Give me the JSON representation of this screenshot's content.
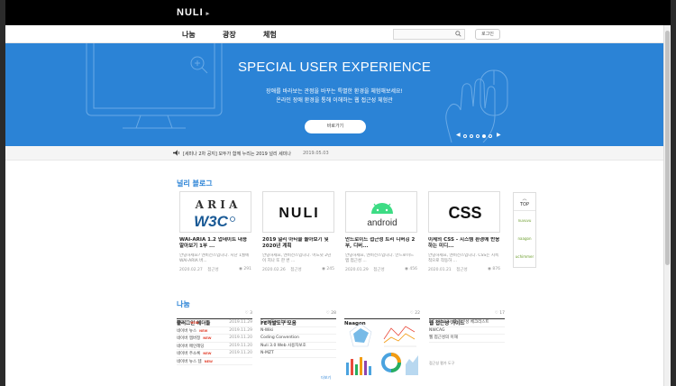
{
  "header": {
    "logo": "NULI",
    "logo_arrow": "▸"
  },
  "nav": {
    "items": [
      {
        "label": "나눔"
      },
      {
        "label": "광장"
      },
      {
        "label": "체험"
      }
    ],
    "search_placeholder": "",
    "login_label": "로그인"
  },
  "hero": {
    "title": "SPECIAL USER EXPERIENCE",
    "line1": "장애를 바라보는 관점을 바꾸는 특별한 환경을 체험해보세요!",
    "line2": "온라인 장애 환경을 통해 이해하는 웹 접근성 체험관",
    "button_label": "바로가기",
    "prev": "◀",
    "next": "▶",
    "slides_total": 5,
    "slide_active": 4
  },
  "notice": {
    "text": "[세미나 2차 공지] 모두가 함께 누리는 2019 널리 세미나",
    "date": "2019.05.03"
  },
  "blog": {
    "title": "널리 블로그",
    "cards": [
      {
        "title": "WAI-ARIA 1.2 업데이트 내용 알아보기 1부 ...",
        "desc": "안녕하세요? 엔비전스입니다. 지난 1월에 WAI-ARIA 버...",
        "date": "2020.02.27",
        "author": "접근성",
        "views": "291",
        "thumb_text": "ARIA"
      },
      {
        "title": "2019 널리 아티클 돌아보기 및 2020년 계획",
        "desc": "안녕하세요, 엔비전스입니다. 어느덧 2년이 지나 또 한 번 ...",
        "date": "2020.02.26",
        "author": "접근성",
        "views": "245",
        "thumb_text": "NULI"
      },
      {
        "title": "안드로이드 접근성 트리 디버깅 2부, 디버...",
        "desc": "안녕하세요, 엔비전스입니다. 안드로이드 앱 접근성 ...",
        "date": "2020.01.29",
        "author": "접근성",
        "views": "456",
        "thumb_text": "android"
      },
      {
        "title": "이제의 CSS - 시스템 환경에 반응하는 미디...",
        "desc": "안녕하세요, 엔비전스입니다. CSS는 지속적으로 작동하 ...",
        "date": "2020.01.21",
        "author": "접근성",
        "views": "876",
        "thumb_text": "CSS"
      }
    ]
  },
  "side_widget": {
    "top_label": "TOP",
    "items": [
      "nuvuvu",
      "naagon",
      "uchimmer"
    ]
  },
  "share": {
    "title": "나눔",
    "columns": [
      {
        "title": "플러그인 헤더들",
        "count": "3",
        "rows": [
          {
            "label": "테이크",
            "new": "NEW",
            "date": "2019.11.29"
          },
          {
            "label": "네이버 뉴스",
            "new": "NEW",
            "date": "2019.11.29"
          },
          {
            "label": "네이버 멤버정",
            "new": "NEW",
            "date": "2019.11.20"
          },
          {
            "label": "네이버 메인헤딩",
            "new": "",
            "date": "2019.11.20"
          },
          {
            "label": "네이버 주소록",
            "new": "NEW",
            "date": "2019.11.20"
          },
          {
            "label": "네이버 뉴스 템",
            "new": "NEW",
            "date": ""
          }
        ]
      },
      {
        "title": "FE개발도구 모음",
        "count": "28",
        "rows": [
          {
            "label": "Font Simulator",
            "new": "",
            "date": ""
          },
          {
            "label": "N-Wiki",
            "new": "",
            "date": ""
          },
          {
            "label": "Coding Convention",
            "new": "",
            "date": ""
          },
          {
            "label": "Nuli 3.0 Web 사용자보호",
            "new": "",
            "date": ""
          },
          {
            "label": "N-MZT",
            "new": "",
            "date": ""
          }
        ],
        "more": "더보기"
      },
      {
        "title": "Naagon",
        "count": "22",
        "rows": []
      },
      {
        "title": "웹 접근성 가이드",
        "count": "17",
        "rows": [
          {
            "label": "PC / Mobile 웹 접근성 체크리스트",
            "new": "",
            "date": ""
          },
          {
            "label": "NWCAG",
            "new": "",
            "date": ""
          },
          {
            "label": "웹 접근성의 이해",
            "new": "",
            "date": ""
          }
        ],
        "footer": "접근성 평가 도구"
      }
    ]
  },
  "colors": {
    "brand_blue": "#2b83d6",
    "new_red": "#e2432f",
    "android_green": "#3ddc84"
  }
}
